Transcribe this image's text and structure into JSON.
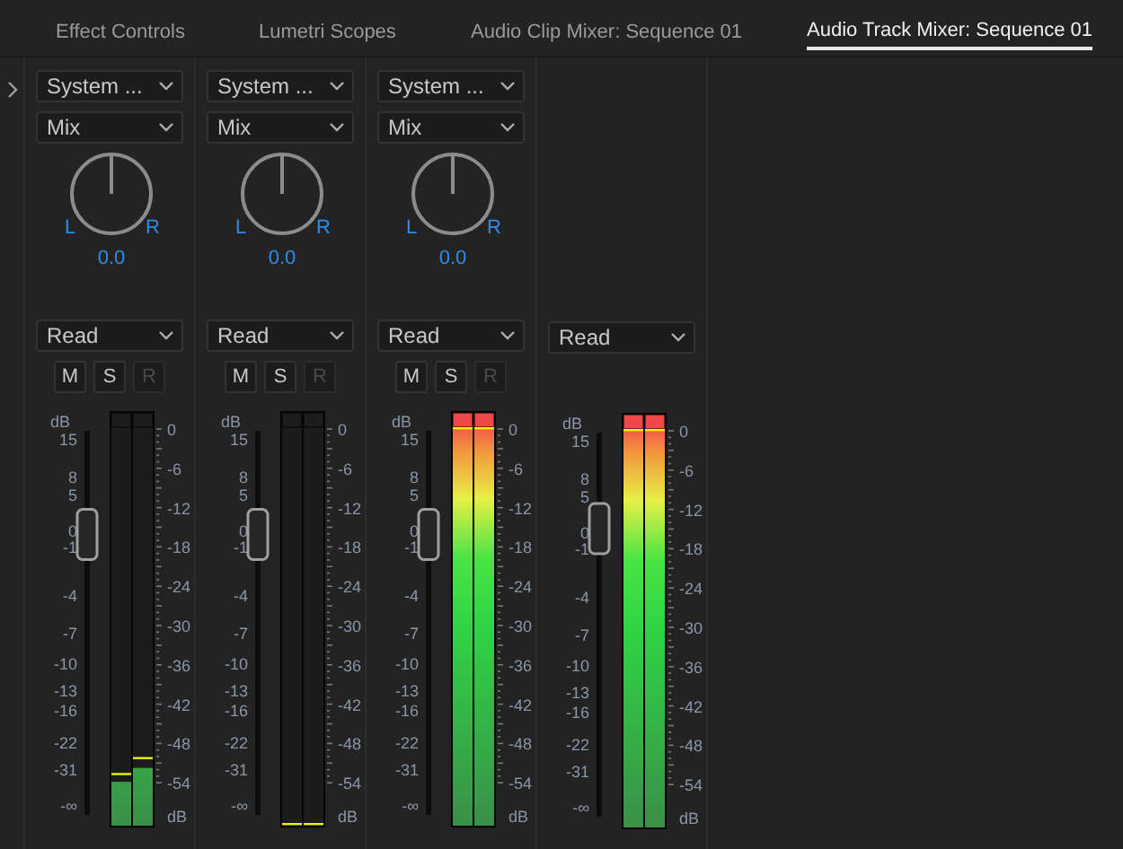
{
  "tabs": [
    {
      "label": "Effect Controls",
      "selected": false
    },
    {
      "label": "Lumetri Scopes",
      "selected": false
    },
    {
      "label": "Audio Clip Mixer: Sequence 01",
      "selected": false
    },
    {
      "label": "Audio Track Mixer: Sequence 01",
      "selected": true
    }
  ],
  "channels": [
    {
      "kind": "track",
      "input": "System ...",
      "mode": "Mix",
      "pan": {
        "left": "L",
        "right": "R",
        "value": "0.0",
        "level": 0.5
      },
      "automation": "Read",
      "buttons": [
        {
          "label": "M",
          "disabled": false
        },
        {
          "label": "S",
          "disabled": false
        },
        {
          "label": "R",
          "disabled": true
        }
      ],
      "fader": {
        "unit": "dB",
        "scale": [
          "15",
          "8",
          "5",
          "0",
          "-1",
          "-4",
          "-7",
          "-10",
          "-13",
          "-16",
          "-22",
          "-31",
          "-∞"
        ],
        "level": 0.73
      },
      "meter": {
        "clip": false,
        "bars": [
          {
            "level": 0.11,
            "peak": {
              "level": 0.13
            }
          },
          {
            "level": 0.145,
            "peak": {
              "level": 0.17
            }
          }
        ],
        "scale": [
          "0",
          "-6",
          "-12",
          "-18",
          "-24",
          "-30",
          "-36",
          "-42",
          "-48",
          "-54"
        ],
        "unit": "dB"
      }
    },
    {
      "kind": "track",
      "input": "System ...",
      "mode": "Mix",
      "pan": {
        "left": "L",
        "right": "R",
        "value": "0.0",
        "level": 0.5
      },
      "automation": "Read",
      "buttons": [
        {
          "label": "M",
          "disabled": false
        },
        {
          "label": "S",
          "disabled": false
        },
        {
          "label": "R",
          "disabled": true
        }
      ],
      "fader": {
        "unit": "dB",
        "scale": [
          "15",
          "8",
          "5",
          "0",
          "-1",
          "-4",
          "-7",
          "-10",
          "-13",
          "-16",
          "-22",
          "-31",
          "-∞"
        ],
        "level": 0.73
      },
      "meter": {
        "clip": false,
        "bars": [
          {
            "level": 0,
            "peak": {
              "level": 0
            }
          },
          {
            "level": 0,
            "peak": {
              "level": 0
            }
          }
        ],
        "scale": [
          "0",
          "-6",
          "-12",
          "-18",
          "-24",
          "-30",
          "-36",
          "-42",
          "-48",
          "-54"
        ],
        "unit": "dB"
      }
    },
    {
      "kind": "track",
      "input": "System ...",
      "mode": "Mix",
      "pan": {
        "left": "L",
        "right": "R",
        "value": "0.0",
        "level": 0.5
      },
      "automation": "Read",
      "buttons": [
        {
          "label": "M",
          "disabled": false
        },
        {
          "label": "S",
          "disabled": false
        },
        {
          "label": "R",
          "disabled": true
        }
      ],
      "fader": {
        "unit": "dB",
        "scale": [
          "15",
          "8",
          "5",
          "0",
          "-1",
          "-4",
          "-7",
          "-10",
          "-13",
          "-16",
          "-22",
          "-31",
          "-∞"
        ],
        "level": 0.73
      },
      "meter": {
        "clip": true,
        "bars": [
          {
            "level": 1,
            "peak": {
              "level": 1
            }
          },
          {
            "level": 1,
            "peak": {
              "level": 1
            }
          }
        ],
        "scale": [
          "0",
          "-6",
          "-12",
          "-18",
          "-24",
          "-30",
          "-36",
          "-42",
          "-48",
          "-54"
        ],
        "unit": "dB"
      }
    },
    {
      "kind": "master",
      "automation": "Read",
      "fader": {
        "unit": "dB",
        "scale": [
          "15",
          "8",
          "5",
          "0",
          "-1",
          "-4",
          "-7",
          "-10",
          "-13",
          "-16",
          "-22",
          "-31",
          "-∞"
        ],
        "level": 0.75
      },
      "meter": {
        "clip": true,
        "bars": [
          {
            "level": 1,
            "peak": {
              "level": 1
            }
          },
          {
            "level": 1,
            "peak": {
              "level": 1
            }
          }
        ],
        "scale": [
          "0",
          "-6",
          "-12",
          "-18",
          "-24",
          "-30",
          "-36",
          "-42",
          "-48",
          "-54"
        ],
        "unit": "dB"
      }
    }
  ]
}
